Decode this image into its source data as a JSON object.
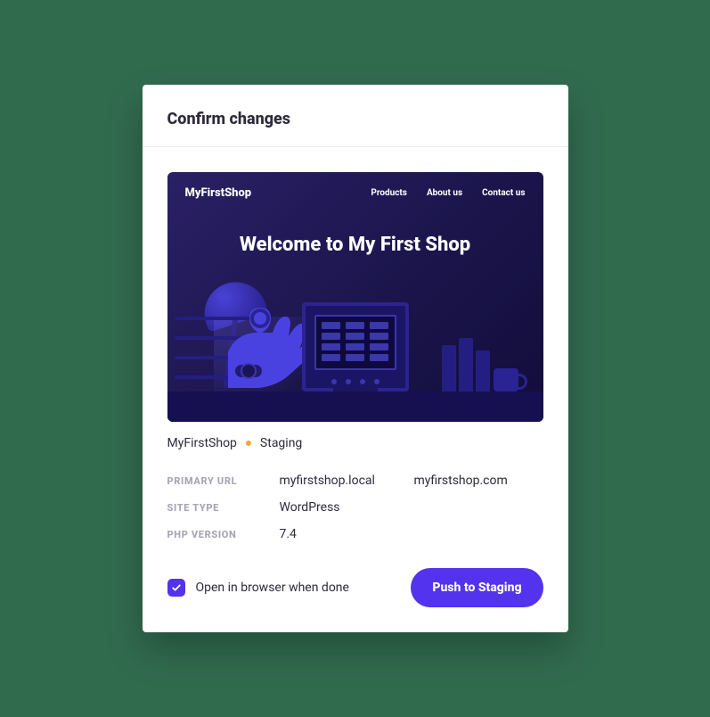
{
  "header": {
    "title": "Confirm changes"
  },
  "preview": {
    "logo": "MyFirstShop",
    "nav": [
      "Products",
      "About us",
      "Contact us"
    ],
    "hero": "Welcome to My First Shop"
  },
  "meta": {
    "site_name": "MyFirstShop",
    "env": "Staging",
    "status_color": "#f2a83b"
  },
  "details": {
    "primary_url_label": "PRIMARY URL",
    "primary_url_local": "myfirstshop.local",
    "primary_url_remote": "myfirstshop.com",
    "site_type_label": "SITE TYPE",
    "site_type": "WordPress",
    "php_label": "PHP VERSION",
    "php_version": "7.4"
  },
  "actions": {
    "open_when_done": "Open in browser when done",
    "push_label": "Push to Staging"
  },
  "colors": {
    "accent": "#5333ed"
  }
}
